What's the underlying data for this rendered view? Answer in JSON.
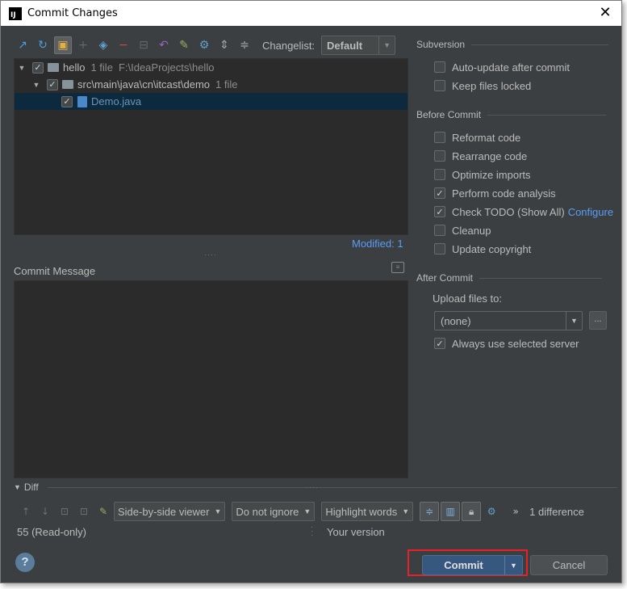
{
  "window": {
    "title": "Commit Changes",
    "app_icon": "IJ"
  },
  "toolbar": {
    "icons": [
      "sync-icon",
      "refresh-icon",
      "history-icon",
      "add-icon",
      "move-icon",
      "remove-icon",
      "diff-icon",
      "revert-icon",
      "edit-icon",
      "settings-icon",
      "expand-icon",
      "collapse-icon"
    ],
    "changelist_label": "Changelist:",
    "changelist_value": "Default"
  },
  "tree": {
    "root": {
      "name": "hello",
      "count": "1 file",
      "path": "F:\\IdeaProjects\\hello"
    },
    "folder": {
      "name": "src\\main\\java\\cn\\itcast\\demo",
      "count": "1 file"
    },
    "file": {
      "name": "Demo.java"
    }
  },
  "modified_label": "Modified: 1",
  "commit_message": {
    "label": "Commit Message",
    "value": ""
  },
  "subversion": {
    "title": "Subversion",
    "options": [
      {
        "label": "Auto-update after commit",
        "checked": false
      },
      {
        "label": "Keep files locked",
        "checked": false
      }
    ]
  },
  "before_commit": {
    "title": "Before Commit",
    "options": [
      {
        "label": "Reformat code",
        "checked": false
      },
      {
        "label": "Rearrange code",
        "checked": false
      },
      {
        "label": "Optimize imports",
        "checked": false
      },
      {
        "label": "Perform code analysis",
        "checked": true
      },
      {
        "label": "Check TODO (Show All)",
        "checked": true,
        "link": "Configure"
      },
      {
        "label": "Cleanup",
        "checked": false
      },
      {
        "label": "Update copyright",
        "checked": false
      }
    ]
  },
  "after_commit": {
    "title": "After Commit",
    "upload_label": "Upload files to:",
    "upload_value": "(none)",
    "browse_label": "...",
    "always_use": {
      "label": "Always use selected server",
      "checked": true
    }
  },
  "diff": {
    "title": "Diff",
    "viewer": "Side-by-side viewer",
    "ignore": "Do not ignore",
    "highlight": "Highlight words",
    "more": "»",
    "differences": "1 difference",
    "left_label": "55 (Read-only)",
    "right_label": "Your version"
  },
  "buttons": {
    "help": "?",
    "commit": "Commit",
    "cancel": "Cancel"
  },
  "colors": {
    "accent": "#365880",
    "link": "#589df6",
    "highlight_border": "#e8202a"
  }
}
